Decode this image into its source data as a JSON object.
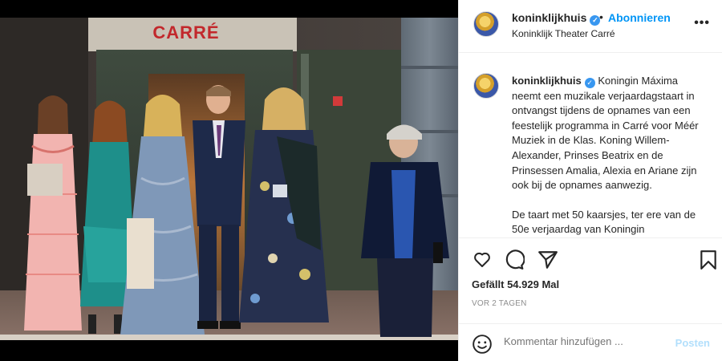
{
  "post": {
    "username": "koninklijkhuis",
    "separator": "•",
    "follow_label": "Abonnieren",
    "location": "Koninklijk Theater Carré",
    "more_glyph": "•••"
  },
  "photo": {
    "sign_text": "CARRÉ"
  },
  "caption": {
    "username": "koninklijkhuis",
    "paragraph1": "Koningin Máxima neemt een muzikale verjaardagstaart in ontvangst tijdens de opnames van een feestelijk programma in Carré voor Méér Muziek in de Klas. Koning Willem-Alexander, Prinses Beatrix en de Prinsessen Amalia, Alexia en Ariane zijn ook bij de opnames aanwezig.",
    "paragraph2": "De taart met 50 kaarsjes, ter ere van de 50e verjaardag van Koningin"
  },
  "stats": {
    "likes": "Gefällt 54.929 Mal",
    "time_ago": "VOR 2 TAGEN"
  },
  "comment": {
    "placeholder": "Kommentar hinzufügen ...",
    "post_label": "Posten"
  },
  "icons": {
    "like": "heart-icon",
    "comment": "comment-icon",
    "share": "paper-plane-icon",
    "save": "bookmark-icon",
    "emoji": "smiley-icon",
    "verified": "verified-badge-icon"
  },
  "colors": {
    "accent": "#0095f6",
    "verified": "#3897f0",
    "post_disabled": "#b2dffc",
    "text": "#262626",
    "muted": "#8e8e8e"
  }
}
